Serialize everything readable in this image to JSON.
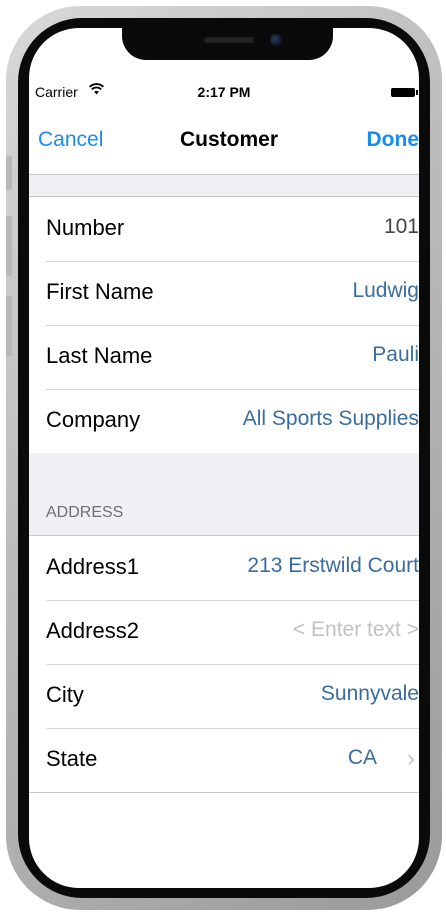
{
  "status_bar": {
    "carrier": "Carrier",
    "wifi_icon": "wifi-icon",
    "time": "2:17 PM",
    "battery_icon": "battery-icon"
  },
  "nav": {
    "left_button": "Cancel",
    "title": "Customer",
    "right_button": "Done"
  },
  "customer_section": {
    "rows": [
      {
        "label": "Number",
        "value": "101"
      },
      {
        "label": "First Name",
        "value": "Ludwig"
      },
      {
        "label": "Last Name",
        "value": "Pauli"
      },
      {
        "label": "Company",
        "value": "All Sports Supplies"
      }
    ]
  },
  "address_section": {
    "header": "ADDRESS",
    "rows": [
      {
        "label": "Address1",
        "value": "213 Erstwild Court"
      },
      {
        "label": "Address2",
        "placeholder": "< Enter text >"
      },
      {
        "label": "City",
        "value": "Sunnyvale"
      },
      {
        "label": "State",
        "value": "CA",
        "chevron": "›"
      }
    ]
  },
  "colors": {
    "accent": "#1a8bf0",
    "value_text": "#3a6d9e",
    "group_background": "#efeff4"
  }
}
